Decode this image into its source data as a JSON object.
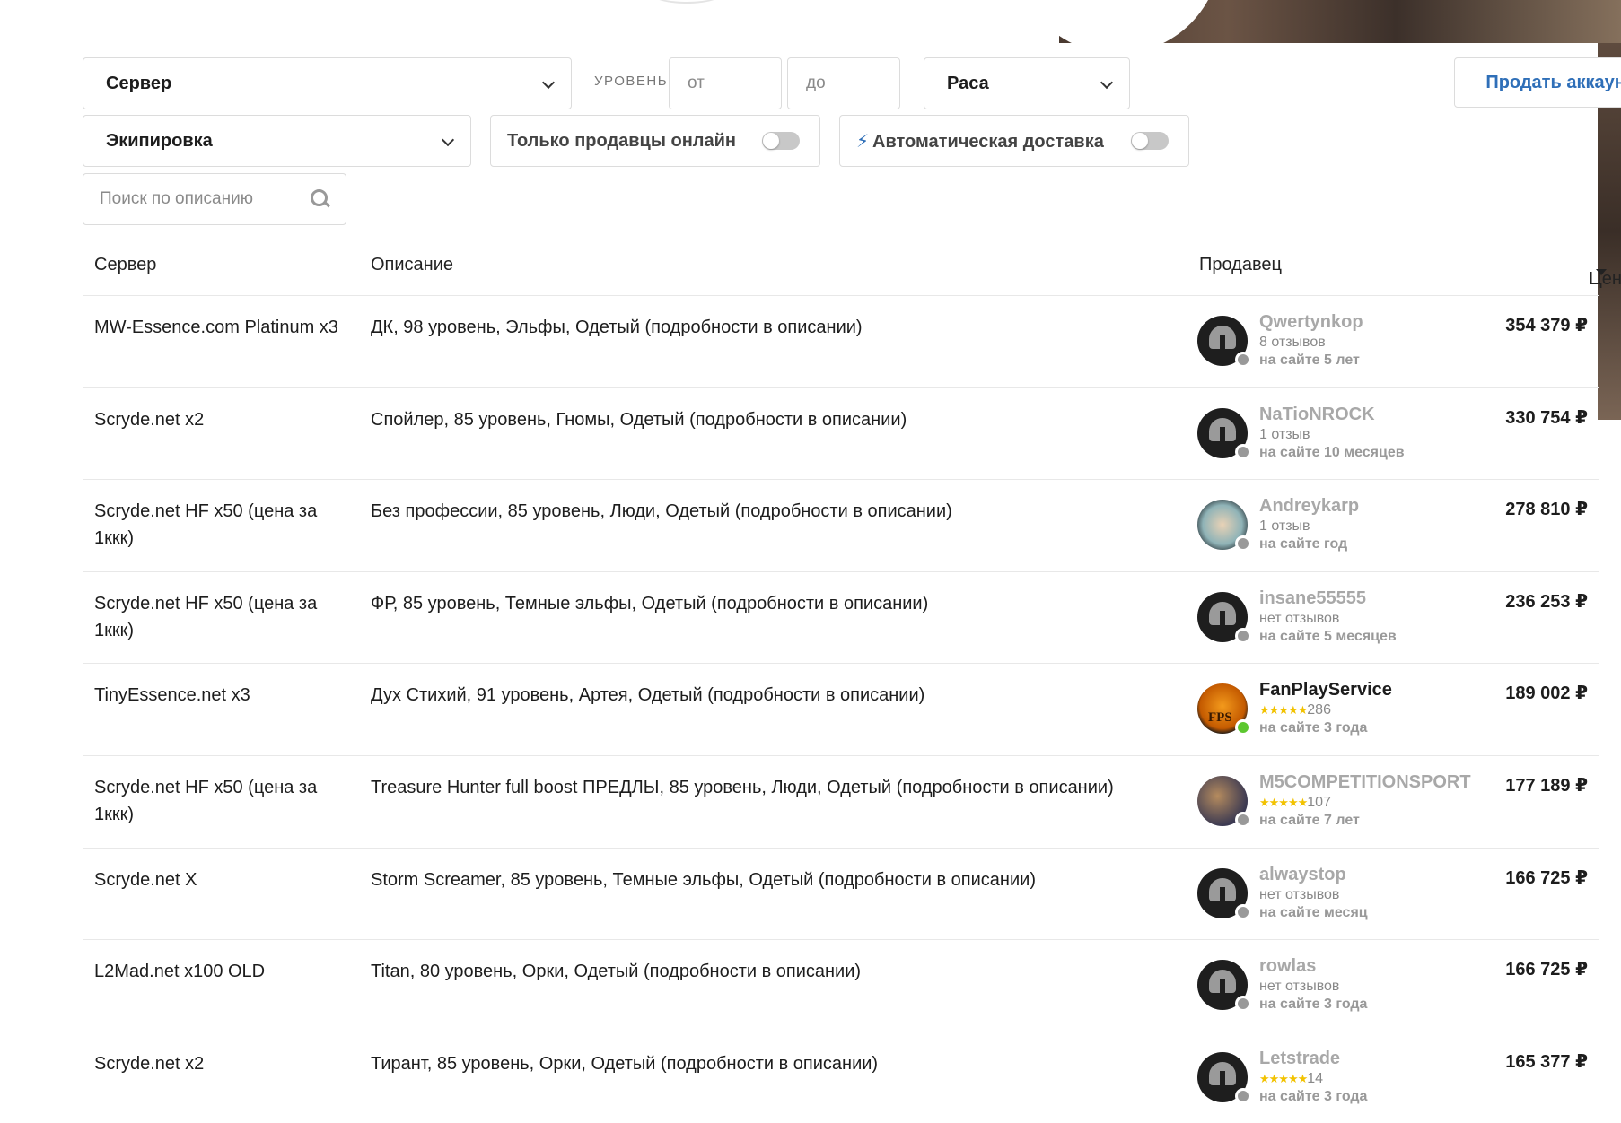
{
  "filters": {
    "server_select": "Сервер",
    "level_label": "уровень",
    "level_from_placeholder": "от",
    "level_to_placeholder": "до",
    "race_select": "Раса",
    "sell_button": "Продать аккаунты",
    "equipment_select": "Экипировка",
    "online_only_label": "Только продавцы онлайн",
    "auto_delivery_label": "Автоматическая доставка",
    "search_placeholder": "Поиск по описанию"
  },
  "table": {
    "headers": {
      "server": "Сервер",
      "description": "Описание",
      "seller": "Продавец",
      "price": "Цена"
    },
    "rows": [
      {
        "server": "MW-Essence.com Platinum x3",
        "description": "ДК, 98 уровень, Эльфы, Одетый (подробности в описании)",
        "seller": "Qwertynkop",
        "reviews": "8 отзывов",
        "since": "на сайте 5 лет",
        "price": "354 379 ₽",
        "online": false,
        "stars": ""
      },
      {
        "server": "Scryde.net x2",
        "description": "Спойлер, 85 уровень, Гномы, Одетый (подробности в описании)",
        "seller": "NaTioNROCK",
        "reviews": "1 отзыв",
        "since": "на сайте 10 месяцев",
        "price": "330 754 ₽",
        "online": false,
        "stars": ""
      },
      {
        "server": "Scryde.net HF x50 (цена за 1ккк)",
        "description": "Без профессии, 85 уровень, Люди, Одетый (подробности в описании)",
        "seller": "Andreykarp",
        "reviews": "1 отзыв",
        "since": "на сайте год",
        "price": "278 810 ₽",
        "online": false,
        "stars": ""
      },
      {
        "server": "Scryde.net HF x50 (цена за 1ккк)",
        "description": "ФР, 85 уровень, Темные эльфы, Одетый (подробности в описании)",
        "seller": "insane55555",
        "reviews": "нет отзывов",
        "since": "на сайте 5 месяцев",
        "price": "236 253 ₽",
        "online": false,
        "stars": ""
      },
      {
        "server": "TinyEssence.net x3",
        "description": "Дух Стихий, 91 уровень, Артея, Одетый (подробности в описании)",
        "seller": "FanPlayService",
        "reviews": "286",
        "since": "на сайте 3 года",
        "price": "189 002 ₽",
        "online": true,
        "stars": "★★★★★"
      },
      {
        "server": "Scryde.net HF x50 (цена за 1ккк)",
        "description": "Treasure Hunter full boost ПРЕДЛЫ, 85 уровень, Люди, Одетый (подробности в описании)",
        "seller": "M5COMPETITIONSPORT",
        "reviews": "107",
        "since": "на сайте 7 лет",
        "price": "177 189 ₽",
        "online": false,
        "stars": "★★★★★"
      },
      {
        "server": "Scryde.net X",
        "description": "Storm Screamer, 85 уровень, Темные эльфы, Одетый (подробности в описании)",
        "seller": "alwaystop",
        "reviews": "нет отзывов",
        "since": "на сайте месяц",
        "price": "166 725 ₽",
        "online": false,
        "stars": ""
      },
      {
        "server": "L2Mad.net x100 OLD",
        "description": "Titan, 80 уровень, Орки, Одетый (подробности в описании)",
        "seller": "rowlas",
        "reviews": "нет отзывов",
        "since": "на сайте 3 года",
        "price": "166 725 ₽",
        "online": false,
        "stars": ""
      },
      {
        "server": "Scryde.net x2",
        "description": "Тирант, 85 уровень, Орки, Одетый (подробности в описании)",
        "seller": "Letstrade",
        "reviews": "14",
        "since": "на сайте 3 года",
        "price": "165 377 ₽",
        "online": false,
        "stars": "★★★★★"
      }
    ]
  },
  "avatars": [
    "helmet",
    "helmet",
    "drawn",
    "helmet",
    "fps",
    "photo",
    "helmet",
    "helmet",
    "helmet"
  ],
  "icons": {
    "online_dot_color": "#5cc72f",
    "offline_dot_color": "#999999",
    "accent": "#2f6fb8"
  }
}
